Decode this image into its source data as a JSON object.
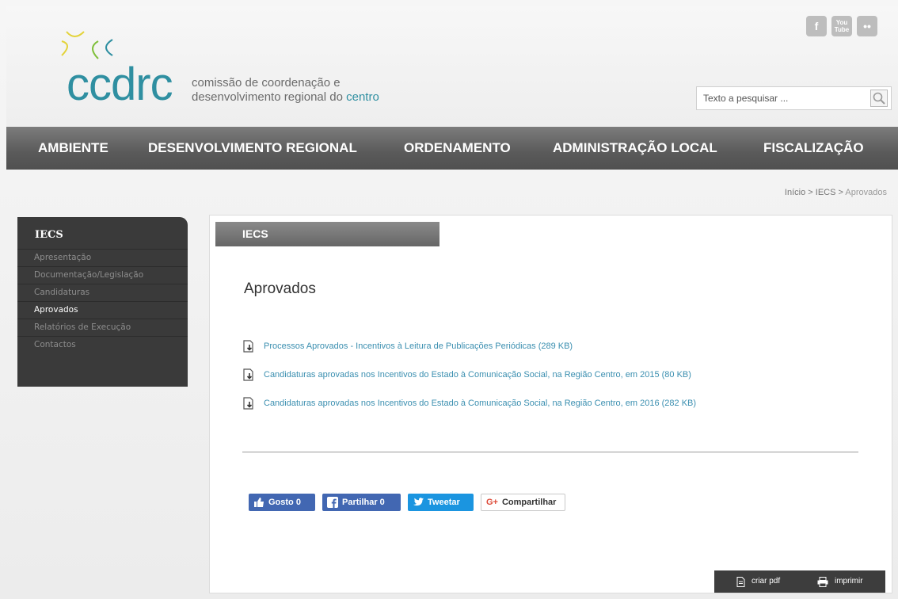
{
  "header": {
    "logo_text": "ccdrc",
    "tagline_line1": "comissão de coordenação e",
    "tagline_line2_prefix": "desenvolvimento regional do ",
    "tagline_line2_accent": "centro",
    "social": {
      "facebook": "f",
      "youtube_top": "You",
      "youtube_bottom": "Tube",
      "flickr": "••"
    },
    "search": {
      "placeholder": "Texto a pesquisar ..."
    }
  },
  "nav": {
    "items": [
      {
        "label": "AMBIENTE"
      },
      {
        "label": "DESENVOLVIMENTO REGIONAL"
      },
      {
        "label": "ORDENAMENTO"
      },
      {
        "label": "ADMINISTRAÇÃO LOCAL"
      },
      {
        "label": "FISCALIZAÇÃO"
      }
    ]
  },
  "breadcrumb": {
    "home": "Início",
    "sep": ">",
    "section": "IECS",
    "current": "Aprovados"
  },
  "sidebar": {
    "title": "IECS",
    "items": [
      {
        "label": "Apresentação"
      },
      {
        "label": "Documentação/Legislação"
      },
      {
        "label": "Candidaturas"
      },
      {
        "label": "Aprovados"
      },
      {
        "label": "Relatórios de Execução"
      },
      {
        "label": "Contactos"
      }
    ]
  },
  "content": {
    "section_tab": "IECS",
    "title": "Aprovados",
    "documents": [
      {
        "label": "Processos Aprovados - Incentivos à Leitura de Publicações Periódicas (289 KB)"
      },
      {
        "label": "Candidaturas aprovadas nos Incentivos do Estado à Comunicação Social, na Região Centro, em 2015 (80 KB)"
      },
      {
        "label": "Candidaturas aprovadas nos Incentivos do Estado à Comunicação Social, na Região Centro, em 2016 (282 KB)"
      }
    ],
    "share": {
      "like": "Gosto 0",
      "share": "Partilhar 0",
      "tweet": "Tweetar",
      "gplus_g": "G+",
      "gplus": "Compartilhar"
    },
    "footer": {
      "pdf": "criar pdf",
      "print": "imprimir"
    }
  },
  "colors": {
    "brand": "#2f8fa1",
    "link": "#3b8fb0",
    "nav_bg": "#5a5a5a",
    "sidebar_bg": "#3a3a3a"
  }
}
